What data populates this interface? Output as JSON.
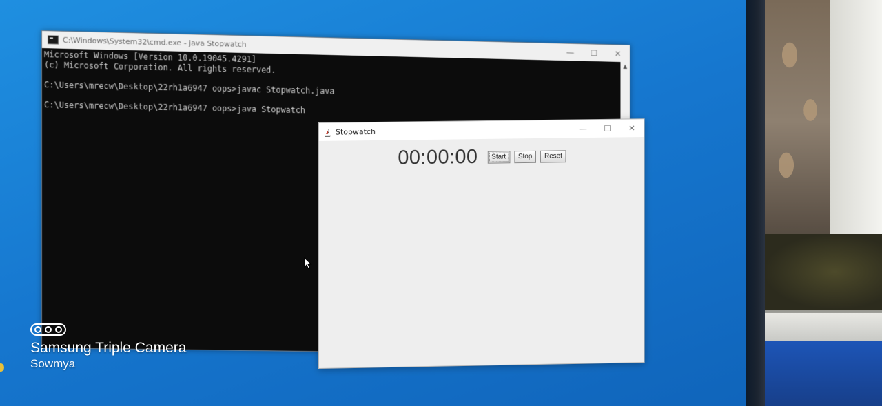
{
  "cmd_window": {
    "title": "C:\\Windows\\System32\\cmd.exe - java  Stopwatch",
    "controls": {
      "minimize": "—",
      "maximize": "☐",
      "close": "✕"
    },
    "lines": [
      "Microsoft Windows [Version 10.0.19045.4291]",
      "(c) Microsoft Corporation. All rights reserved.",
      "",
      "C:\\Users\\mrecw\\Desktop\\22rh1a6947 oops>javac Stopwatch.java",
      "",
      "C:\\Users\\mrecw\\Desktop\\22rh1a6947 oops>java Stopwatch"
    ]
  },
  "stopwatch_window": {
    "title": "Stopwatch",
    "controls": {
      "minimize": "—",
      "maximize": "☐",
      "close": "✕"
    },
    "time_display": "00:00:00",
    "buttons": {
      "start": "Start",
      "stop": "Stop",
      "reset": "Reset"
    }
  },
  "camera_watermark": {
    "brand": "Samsung Triple Camera",
    "owner": "Sowmya"
  },
  "icons": [
    "cmd-icon",
    "java-icon",
    "mouse-cursor-icon",
    "triple-camera-icon"
  ]
}
